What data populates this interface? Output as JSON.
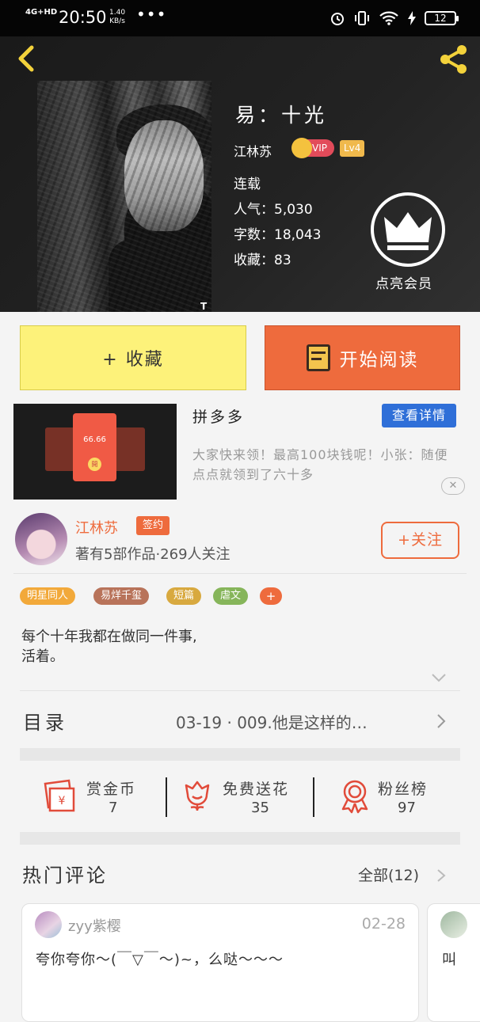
{
  "status_bar": {
    "network": "4G+HD",
    "time": "20:50",
    "speed_value": "1.40",
    "speed_unit": "KB/s",
    "more": "•••",
    "battery": "12"
  },
  "book": {
    "title": "易：十光",
    "author": "江林苏",
    "vip": "VIP",
    "level": "Lv4",
    "status": "连载",
    "popularity": "人气：5,030",
    "word_count": "字数：18,043",
    "favorites": "收藏：83",
    "member_label": "点亮会员",
    "cover_mark": "T"
  },
  "actions": {
    "collect": "+ 收藏",
    "read": "开始阅读"
  },
  "ad": {
    "title": "拼多多",
    "detail_button": "查看详情",
    "description": "大家快来领！最高100块钱呢！小张：随便点点就领到了六十多",
    "close": "✕",
    "card_amount": "66.66",
    "card_coin": "開"
  },
  "author_card": {
    "name": "江林苏",
    "badge": "签约",
    "works": "著有5部作品·269人关注",
    "follow": "+关注"
  },
  "tags": [
    "明星同人",
    "易烊千玺",
    "短篇",
    "虐文",
    "+"
  ],
  "intro": {
    "line1": "每个十年我都在做同一件事,",
    "line2": "活着。"
  },
  "toc": {
    "label": "目录",
    "latest": "03-19 · 009.他是这样的…"
  },
  "stats": [
    {
      "label": "赏金币",
      "value": "7",
      "icon": "reward-envelope-icon"
    },
    {
      "label": "免费送花",
      "value": "35",
      "icon": "flower-icon"
    },
    {
      "label": "粉丝榜",
      "value": "97",
      "icon": "medal-icon"
    }
  ],
  "comments": {
    "label": "热门评论",
    "all": "全部(12)",
    "items": [
      {
        "user": "zyy紫樱",
        "date": "02-28",
        "text": "夸你夸你～(￣▽￣～)~，么哒～～～"
      },
      {
        "text": "叫"
      }
    ]
  },
  "colors": {
    "accent": "#ee6b3d",
    "collect_bg": "#fdf27a",
    "detail_blue": "#2f6fd8",
    "header_bg": "#1a1a1a"
  }
}
